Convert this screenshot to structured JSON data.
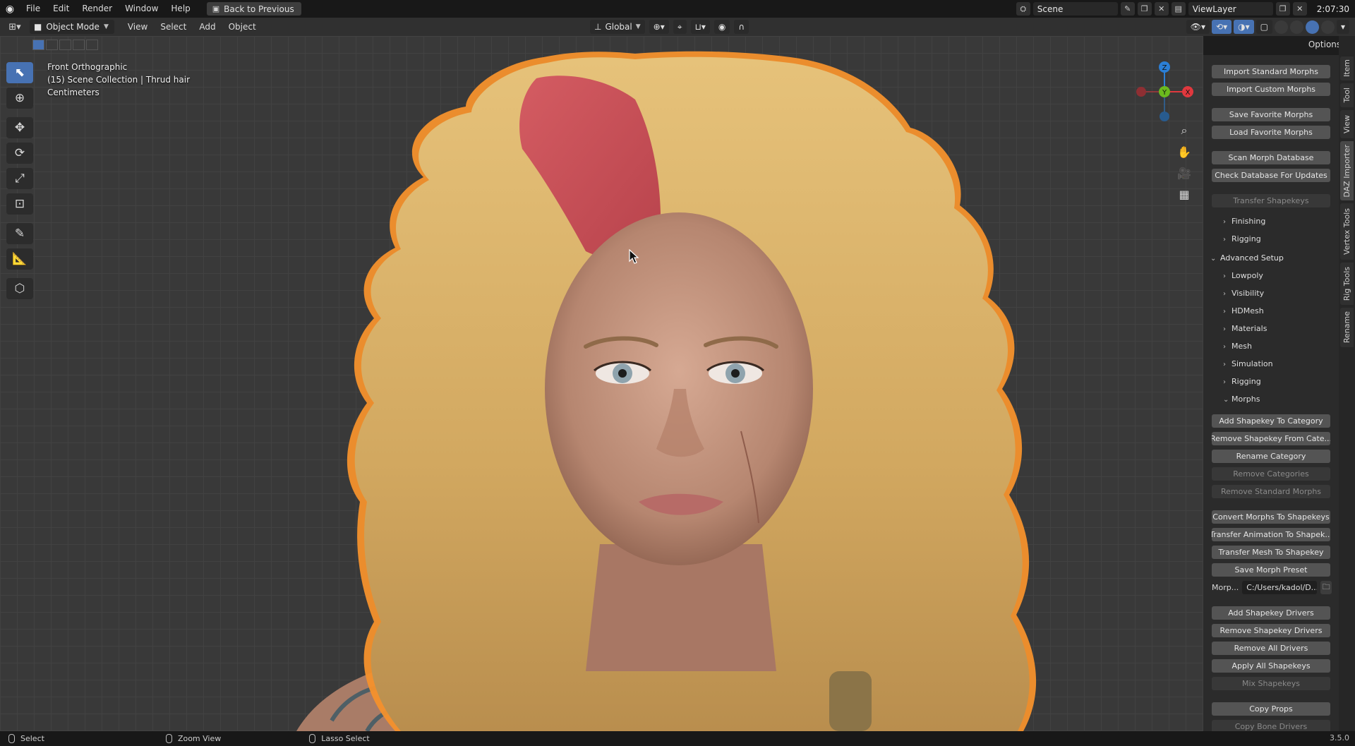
{
  "topbar": {
    "menus": [
      "File",
      "Edit",
      "Render",
      "Window",
      "Help"
    ],
    "back_button": "Back to Previous",
    "scene_name": "Scene",
    "view_layer": "ViewLayer",
    "clock": "2:07:30"
  },
  "viewport_header": {
    "mode": "Object Mode",
    "menus": [
      "View",
      "Select",
      "Add",
      "Object"
    ],
    "orientation": "Global",
    "options": "Options"
  },
  "viewport": {
    "view_name": "Front Orthographic",
    "collection": "(15) Scene Collection | Thrud hair",
    "units": "Centimeters",
    "gizmo": {
      "z": "Z",
      "y": "Y",
      "x": "X"
    }
  },
  "sidebar_tabs": [
    "Item",
    "Tool",
    "View",
    "DAZ Importer",
    "Vertex Tools",
    "Rig Tools",
    "Rename"
  ],
  "npanel": {
    "top_buttons": [
      {
        "label": "Import Standard Morphs",
        "enabled": true
      },
      {
        "label": "Import Custom Morphs",
        "enabled": true
      },
      {
        "label": "Save Favorite Morphs",
        "enabled": true
      },
      {
        "label": "Load Favorite Morphs",
        "enabled": true
      },
      {
        "label": "Scan Morph Database",
        "enabled": true
      },
      {
        "label": "Check Database For Updates",
        "enabled": true
      },
      {
        "label": "Transfer Shapekeys",
        "enabled": false
      }
    ],
    "sections": [
      "Finishing",
      "Rigging"
    ],
    "advanced_setup": "Advanced Setup",
    "advanced_items": [
      "Lowpoly",
      "Visibility",
      "HDMesh",
      "Materials",
      "Mesh",
      "Simulation",
      "Rigging",
      "Morphs"
    ],
    "morph_buttons": [
      {
        "label": "Add Shapekey To Category",
        "enabled": true
      },
      {
        "label": "Remove Shapekey From Cate...",
        "enabled": true
      },
      {
        "label": "Rename Category",
        "enabled": true
      },
      {
        "label": "Remove Categories",
        "enabled": false
      },
      {
        "label": "Remove Standard Morphs",
        "enabled": false
      },
      {
        "label": "Convert Morphs To Shapekeys",
        "enabled": true
      },
      {
        "label": "Transfer Animation To Shapek...",
        "enabled": true
      },
      {
        "label": "Transfer Mesh To Shapekey",
        "enabled": true
      },
      {
        "label": "Save Morph Preset",
        "enabled": true
      }
    ],
    "morph_path_label": "Morp...",
    "morph_path_value": "C:/Users/kadol/D...",
    "driver_buttons": [
      {
        "label": "Add Shapekey Drivers",
        "enabled": true
      },
      {
        "label": "Remove Shapekey Drivers",
        "enabled": true
      },
      {
        "label": "Remove All Drivers",
        "enabled": true
      },
      {
        "label": "Apply All Shapekeys",
        "enabled": true
      },
      {
        "label": "Mix Shapekeys",
        "enabled": false
      },
      {
        "label": "Copy Props",
        "enabled": true
      },
      {
        "label": "Copy Bone Drivers",
        "enabled": false
      }
    ]
  },
  "statusbar": {
    "select": "Select",
    "zoom": "Zoom View",
    "lasso": "Lasso Select",
    "version": "3.5.0"
  },
  "colors": {
    "accent": "#4772b3",
    "outline": "#f4912c",
    "hair": "#d9b46a",
    "hair_red": "#c9555a",
    "skin": "#c89a82"
  }
}
